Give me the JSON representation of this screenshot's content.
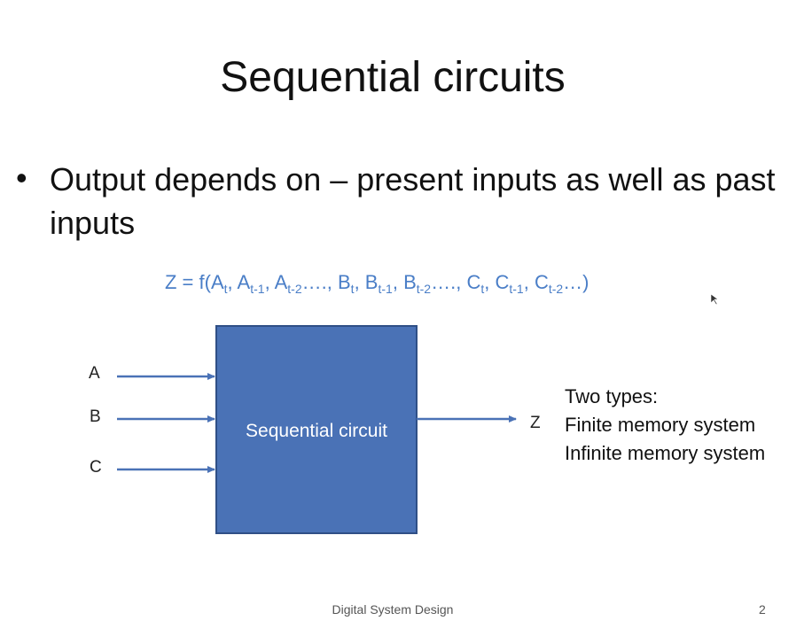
{
  "slide": {
    "title": "Sequential circuits",
    "bullet": "Output depends on – present inputs as well as past inputs",
    "formula": {
      "prefix": "Z = f(",
      "terms": [
        {
          "base": "A",
          "sub": "t"
        },
        {
          "base": "A",
          "sub": "t-1"
        },
        {
          "base": "A",
          "sub": "t-2",
          "suffix": "…."
        },
        {
          "base": "B",
          "sub": "t"
        },
        {
          "base": "B",
          "sub": "t-1"
        },
        {
          "base": "B",
          "sub": "t-2",
          "suffix": "…."
        },
        {
          "base": "C",
          "sub": "t"
        },
        {
          "base": "C",
          "sub": "t-1"
        },
        {
          "base": "C",
          "sub": "t-2",
          "suffix": "…"
        }
      ],
      "suffix": ")"
    },
    "diagram": {
      "inputs": [
        "A",
        "B",
        "C"
      ],
      "block_label": "Sequential circuit",
      "output": "Z",
      "block_color": "#4a72b6",
      "block_border": "#2f4f86",
      "arrow_color": "#4a72b6"
    },
    "types": {
      "heading": "Two types:",
      "items": [
        "Finite memory system",
        "Infinite memory system"
      ]
    },
    "footer": {
      "center": "Digital System Design",
      "page_number": "2"
    },
    "formula_color": "#4a7ec7"
  }
}
